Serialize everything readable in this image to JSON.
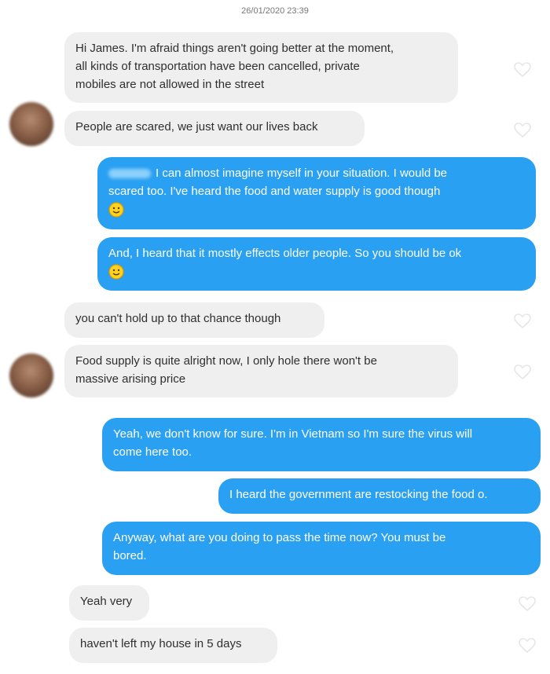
{
  "conversation": {
    "timestamp": "26/01/2020 23:39",
    "messages": [
      {
        "direction": "in",
        "lines": [
          "Hi James. I'm afraid things aren't going better at the moment,",
          "all kinds of transportation have been cancelled, private",
          "mobiles are not allowed in the street"
        ]
      },
      {
        "direction": "in",
        "lines": [
          "People are scared, we just want our lives back"
        ]
      },
      {
        "direction": "out",
        "lines": [
          "I can almost imagine myself in your situation. I would be",
          "scared too. I've heard the food and water supply is good though"
        ],
        "emoji": "smiley-face"
      },
      {
        "direction": "out",
        "lines": [
          "And, I heard that it mostly effects older people. So you should be ok"
        ],
        "emoji": "smiley-face"
      },
      {
        "direction": "in",
        "lines": [
          "you can't hold up to that chance though"
        ]
      },
      {
        "direction": "in",
        "lines": [
          "Food supply is quite alright now, I only hole there won't be",
          "massive arising price"
        ]
      },
      {
        "direction": "out",
        "lines": [
          "Yeah, we don't know for sure. I'm in Vietnam so I'm sure the virus will",
          "come here too."
        ]
      },
      {
        "direction": "out",
        "lines": [
          "I heard the government are restocking the food o."
        ]
      },
      {
        "direction": "out",
        "lines": [
          "Anyway, what are you doing to pass the time now? You must be",
          "bored."
        ]
      },
      {
        "direction": "in",
        "lines": [
          "Yeah very"
        ]
      },
      {
        "direction": "in",
        "lines": [
          "haven't left my house in 5 days"
        ]
      }
    ]
  },
  "icons": {
    "like": "heart-outline-icon",
    "emoji": "smiley-face-icon",
    "avatar": "contact-avatar"
  },
  "colors": {
    "incoming_bubble": "#efefef",
    "outgoing_bubble": "#2aa0f2",
    "outgoing_text": "#ffffff",
    "heart_outline": "#e6e6e6"
  }
}
